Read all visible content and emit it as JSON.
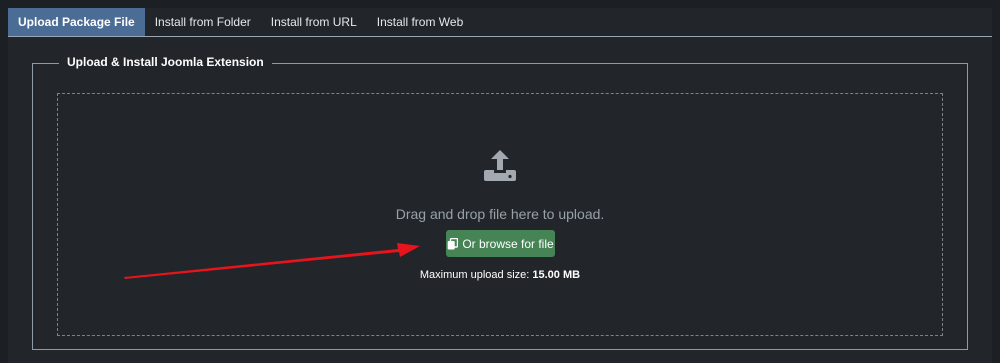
{
  "tabs": [
    {
      "label": "Upload Package File",
      "active": true
    },
    {
      "label": "Install from Folder",
      "active": false
    },
    {
      "label": "Install from URL",
      "active": false
    },
    {
      "label": "Install from Web",
      "active": false
    }
  ],
  "upload": {
    "legend": "Upload & Install Joomla Extension",
    "drag_text": "Drag and drop file here to upload.",
    "browse_label": "Or browse for file",
    "max_size_label": "Maximum upload size:",
    "max_size_value": "15.00 MB"
  },
  "colors": {
    "background": "#1c1f24",
    "panel": "#22262b",
    "active_tab": "#4a6c95",
    "button": "#468455",
    "annotation_arrow": "#e8141c"
  },
  "icons": {
    "upload": "upload-icon",
    "browse": "copy-icon"
  }
}
